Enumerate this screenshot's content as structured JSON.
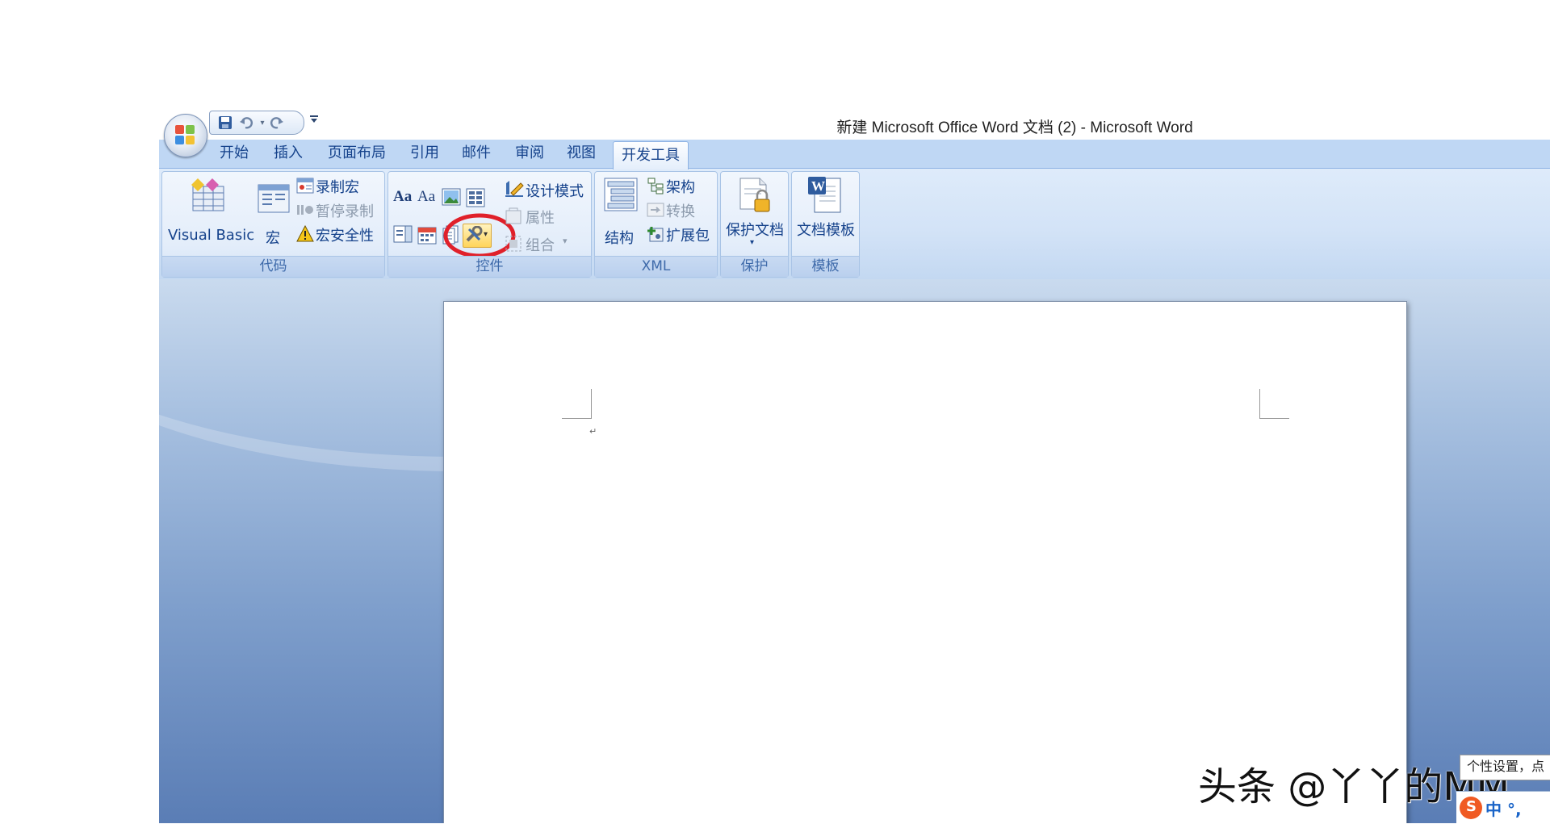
{
  "window": {
    "title": "新建 Microsoft Office Word 文档 (2) - Microsoft Word"
  },
  "qat": {
    "more_icon": "customize-qat-icon",
    "items": [
      "save-icon",
      "undo-icon",
      "redo-icon"
    ]
  },
  "tabs": [
    "开始",
    "插入",
    "页面布局",
    "引用",
    "邮件",
    "审阅",
    "视图",
    "开发工具"
  ],
  "active_tab": "开发工具",
  "ribbon": {
    "code": {
      "name": "代码",
      "visual_basic": "Visual Basic",
      "macros": "宏",
      "record_macro": "录制宏",
      "pause_recording": "暂停录制",
      "macro_security": "宏安全性"
    },
    "controls": {
      "name": "控件",
      "design_mode": "设计模式",
      "properties": "属性",
      "group": "组合",
      "highlight_color": "#e0202a"
    },
    "xml": {
      "name": "XML",
      "structure": "结构",
      "schema": "架构",
      "transform": "转换",
      "expansion_packs": "扩展包"
    },
    "protect": {
      "name": "保护",
      "protect_document": "保护文档"
    },
    "templates": {
      "name": "模板",
      "document_template": "文档模板"
    }
  },
  "document": {
    "paragraph_mark": "↵"
  },
  "overlay": {
    "watermark": "头条 @丫丫的MM",
    "ime_tip": "个性设置，点",
    "ime_status": "中 °,"
  },
  "colors": {
    "tab_bar": "#bfd7f4",
    "tab_text": "#15428b",
    "group_label": "#3e6aaa",
    "workspace": "#7f9fcc"
  }
}
